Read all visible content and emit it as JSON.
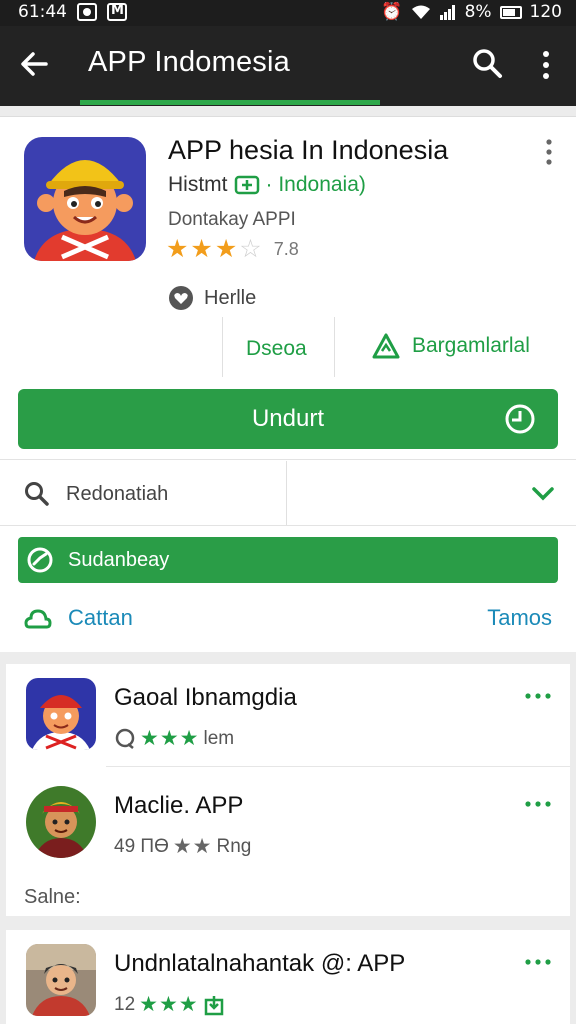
{
  "status_bar": {
    "time": "61:44",
    "battery": "8%",
    "extra": "120"
  },
  "app_bar": {
    "title": "APP Indomesia"
  },
  "app": {
    "title": "APP hesia In Indonesia",
    "developer_left": "Histmt",
    "developer_right": "· Indonaia)",
    "subtitle": "Dontakay APPI",
    "rating_value": "7.8",
    "stars_filled": 3,
    "wishlist_label": "Herlle",
    "meta_left": "Dseoa",
    "meta_right": "Bargamlarlal",
    "install_label": "Undurt"
  },
  "search": {
    "placeholder": "Redonatiah"
  },
  "banner": {
    "text": "Sudanbeay"
  },
  "links": {
    "left": "Cattan",
    "right": "Tamos"
  },
  "list": {
    "items": [
      {
        "title": "Gaoal Ibnamgdia",
        "sub_prefix": "",
        "stars": "★★★",
        "sub_suffix": "lem"
      },
      {
        "title": "Maclie. APP",
        "sub_prefix": "49 ПӨ",
        "stars": "★★",
        "sub_suffix": "Rng"
      },
      {
        "title": "Undnlatalnahantak @: APP",
        "sub_prefix": "12",
        "stars": "★★★",
        "sub_suffix": ""
      }
    ],
    "section_label": "Salne:"
  },
  "colors": {
    "accent": "#2a9d47",
    "link": "#1b8ab8",
    "star": "#f29d1b",
    "appbar": "#232323"
  }
}
